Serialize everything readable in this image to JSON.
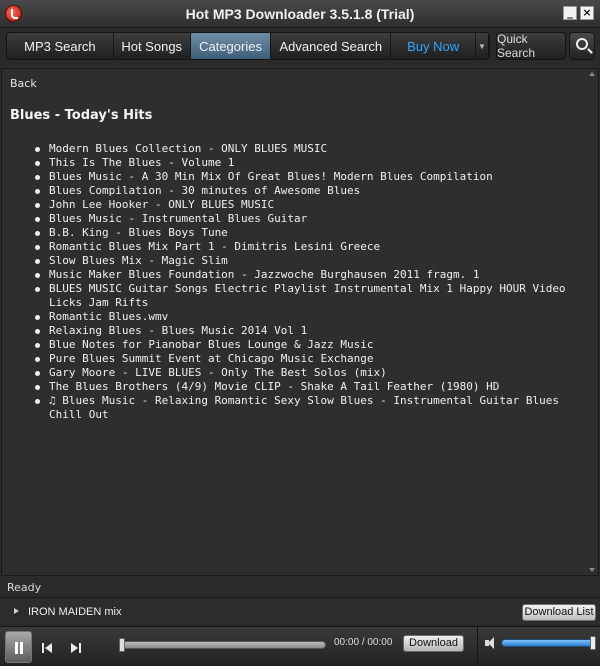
{
  "window": {
    "title": "Hot MP3 Downloader  3.5.1.8  (Trial)",
    "minimize_label": "_",
    "close_label": "×"
  },
  "nav": {
    "tabs": [
      {
        "label": "MP3 Search"
      },
      {
        "label": "Hot Songs"
      },
      {
        "label": "Categories"
      },
      {
        "label": "Advanced Search"
      },
      {
        "label": "Buy Now"
      }
    ],
    "active_tab": "Categories",
    "buy_color": "#2fa6ff",
    "dropdown_icon": "chevron-down-icon",
    "quick_search_label": "Quick Search"
  },
  "content": {
    "back_label": "Back",
    "heading": "Blues - Today's Hits",
    "items": [
      "Modern Blues Collection - ONLY BLUES MUSIC",
      "This Is The Blues - Volume 1",
      "Blues Music - A 30 Min Mix Of Great Blues! Modern Blues Compilation",
      "Blues Compilation - 30 minutes of Awesome Blues",
      "John Lee Hooker - ONLY BLUES MUSIC",
      "Blues Music - Instrumental Blues Guitar",
      "B.B. King - Blues Boys Tune",
      "Romantic Blues Mix Part 1 - Dimitris Lesini Greece",
      "Slow Blues Mix - Magic Slim",
      "Music Maker Blues Foundation - Jazzwoche Burghausen 2011 fragm. 1",
      "BLUES MUSIC Guitar Songs Electric Playlist Instrumental Mix 1 Happy HOUR Video Licks Jam Rifts",
      "Romantic Blues.wmv",
      "Relaxing Blues - Blues Music 2014 Vol 1",
      "Blue Notes for Pianobar Blues Lounge & Jazz Music",
      "Pure Blues Summit Event at Chicago Music Exchange",
      "Gary Moore - LIVE BLUES - Only The Best Solos (mix)",
      "The Blues Brothers (4/9) Movie CLIP - Shake A Tail Feather (1980) HD",
      "♫ Blues Music - Relaxing Romantic Sexy Slow Blues - Instrumental Guitar Blues Chill Out"
    ]
  },
  "status": {
    "text": "Ready"
  },
  "now_playing": {
    "track": "IRON MAIDEN mix",
    "download_list_label": "Download List"
  },
  "player": {
    "time": "00:00 / 00:00",
    "download_label": "Download",
    "seek_progress": 0,
    "volume_level": 1.0
  }
}
